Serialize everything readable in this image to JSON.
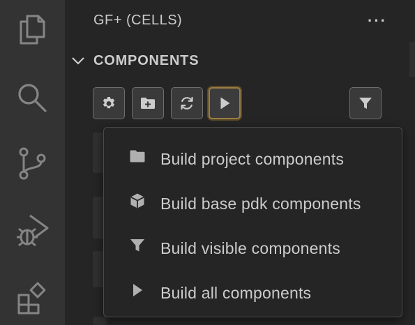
{
  "sidebar": {
    "title": "GF+ (CELLS)",
    "more_label": "···"
  },
  "section": {
    "title": "COMPONENTS"
  },
  "toolbar": {
    "buttons": [
      {
        "icon": "gear-icon"
      },
      {
        "icon": "new-folder-icon"
      },
      {
        "icon": "refresh-icon"
      },
      {
        "icon": "play-icon",
        "active": true
      },
      {
        "icon": "filter-icon"
      }
    ],
    "active_border_color": "#9a7d45"
  },
  "menu": {
    "items": [
      {
        "label": "Build project components",
        "icon": "folder-icon"
      },
      {
        "label": "Build base pdk components",
        "icon": "package-icon"
      },
      {
        "label": "Build visible components",
        "icon": "filter-icon"
      },
      {
        "label": "Build all components",
        "icon": "play-icon"
      }
    ]
  },
  "activity_bar": {
    "items": [
      {
        "icon": "explorer-icon"
      },
      {
        "icon": "search-icon"
      },
      {
        "icon": "source-control-icon"
      },
      {
        "icon": "run-debug-icon"
      },
      {
        "icon": "extensions-icon"
      }
    ]
  },
  "colors": {
    "activity_bar_bg": "#333333",
    "sidebar_bg": "#252526",
    "text": "#cccccc",
    "icon": "#858585"
  }
}
